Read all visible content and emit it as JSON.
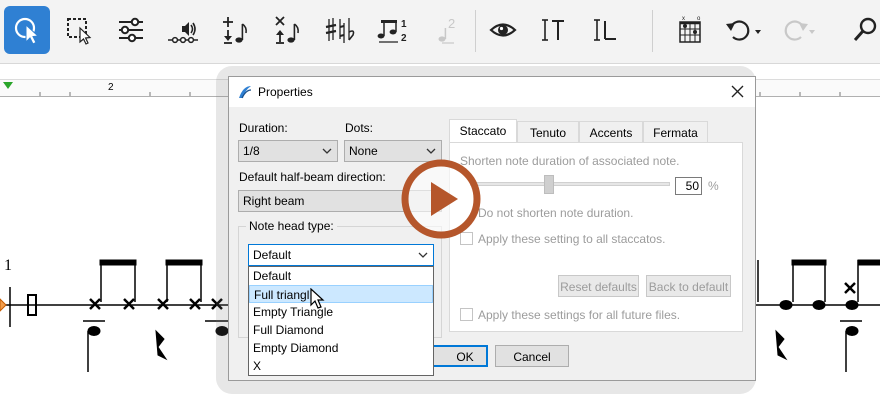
{
  "toolbar": {
    "tools": [
      {
        "name": "select-tool",
        "icon": "select-cursor-icon",
        "active": true
      },
      {
        "name": "rect-select-tool",
        "icon": "rectangle-select-icon"
      },
      {
        "name": "mixer-tool",
        "icon": "sliders-icon"
      },
      {
        "name": "playback-tool",
        "icon": "speaker-icon"
      },
      {
        "name": "add-note-tool",
        "icon": "add-note-icon"
      },
      {
        "name": "delete-note-tool",
        "icon": "remove-note-icon"
      },
      {
        "name": "accidentals-tool",
        "icon": "accidentals-icon"
      },
      {
        "name": "tuplet-tool",
        "icon": "tuplet-icon",
        "text": "1 2"
      },
      {
        "name": "voice2-tool",
        "icon": "voice-two-icon",
        "text": "2"
      },
      {
        "name": "view-tool",
        "icon": "eye-icon"
      },
      {
        "name": "text-tool",
        "icon": "text-cursor-icon",
        "text": "IT"
      },
      {
        "name": "lyrics-tool",
        "icon": "lyrics-icon",
        "text": "IL"
      },
      {
        "name": "chord-diagram-tool",
        "icon": "chord-grid-icon"
      },
      {
        "name": "undo",
        "icon": "undo-icon"
      },
      {
        "name": "redo",
        "icon": "redo-icon"
      },
      {
        "name": "search",
        "icon": "search-icon"
      }
    ]
  },
  "ruler": {
    "marker": "2"
  },
  "score": {
    "measure_number": "1"
  },
  "dialog": {
    "title": "Properties",
    "duration_label": "Duration:",
    "duration_value": "1/8",
    "dots_label": "Dots:",
    "dots_value": "None",
    "halfbeam_label": "Default half-beam direction:",
    "halfbeam_value": "Right beam",
    "notehead_group_label": "Note head type:",
    "notehead_value": "Default",
    "notehead_options": [
      "Default",
      "Full triangle",
      "Empty Triangle",
      "Full Diamond",
      "Empty Diamond",
      "X"
    ],
    "notehead_highlighted": "Full triangle",
    "notehead_highlight_visible": "Full triangl",
    "tabs": [
      "Staccato",
      "Tenuto",
      "Accents",
      "Fermata"
    ],
    "active_tab": "Staccato",
    "staccato": {
      "shorten_label": "Shorten note duration of associated note.",
      "shorten_value": "50",
      "percent": "%",
      "slider_fraction": 0.42,
      "no_shorten_label": "Do not shorten note duration.",
      "apply_all_label": "Apply these setting to all staccatos.",
      "reset_defaults": "Reset defaults",
      "back_to_default": "Back to default",
      "apply_future_label": "Apply these settings for all future files."
    },
    "ok_label": "OK",
    "cancel_label": "Cancel"
  },
  "colors": {
    "accent": "#2f80d3",
    "play_button": "#b5562b",
    "dialog_bg": "#f0f0f0",
    "highlight": "#cce8ff",
    "focus_border": "#0078d7"
  }
}
